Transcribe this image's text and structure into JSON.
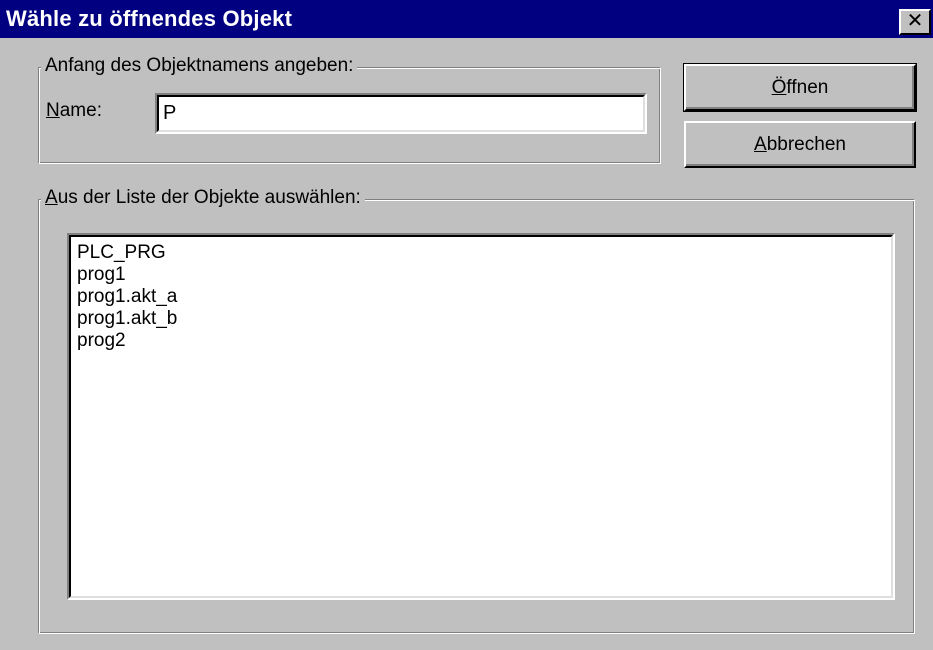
{
  "window": {
    "title": "Wähle zu öffnendes Objekt",
    "close_glyph": "✕"
  },
  "name_group": {
    "legend": "Anfang des Objektnamens angeben:",
    "label_mnemonic": "N",
    "label_rest": "ame:",
    "input_value": "P"
  },
  "buttons": {
    "open_mnemonic": "Ö",
    "open_rest": "ffnen",
    "cancel_mnemonic": "A",
    "cancel_rest": "bbrechen"
  },
  "list_group": {
    "legend_mnemonic": "A",
    "legend_rest": "us der Liste der Objekte auswählen:",
    "items": [
      "PLC_PRG",
      "prog1",
      "prog1.akt_a",
      "prog1.akt_b",
      "prog2"
    ]
  },
  "colors": {
    "titlebar": "#000080",
    "face": "#c0c0c0"
  }
}
